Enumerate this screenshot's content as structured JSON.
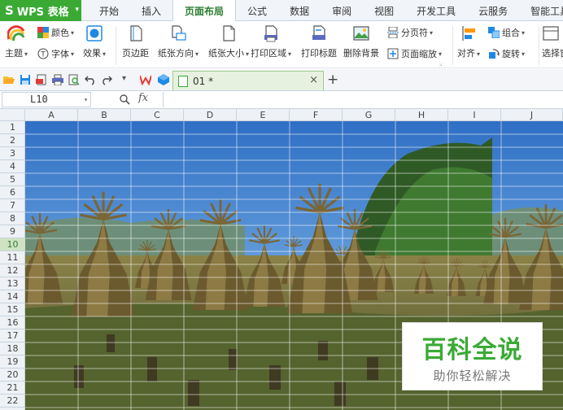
{
  "app": {
    "title": "WPS 表格",
    "tabs": [
      "开始",
      "插入",
      "页面布局",
      "公式",
      "数据",
      "审阅",
      "视图",
      "开发工具",
      "云服务",
      "智能工具箱"
    ],
    "active_tab": "页面布局"
  },
  "ribbon": {
    "theme": "主题",
    "colors": "颜色",
    "fonts": "字体",
    "effects": "效果",
    "margins": "页边距",
    "orientation": "纸张方向",
    "size": "纸张大小",
    "print_area": "打印区域",
    "print_titles": "打印标题",
    "delete_background": "删除背景",
    "page_break": "分页符",
    "page_zoom": "页面缩放",
    "align": "对齐",
    "group": "组合",
    "rotate": "旋转",
    "selection_pane": "选择窗格"
  },
  "document": {
    "tab_name": "01 *"
  },
  "formula_bar": {
    "name_box": "L10",
    "fx_label": "fx",
    "formula": ""
  },
  "sheet": {
    "columns": [
      "A",
      "B",
      "C",
      "D",
      "E",
      "F",
      "G",
      "H",
      "I",
      "J"
    ],
    "rows": [
      "1",
      "2",
      "3",
      "4",
      "5",
      "6",
      "7",
      "8",
      "9",
      "10",
      "11",
      "12",
      "13",
      "14",
      "15",
      "16",
      "17",
      "18",
      "19",
      "20",
      "21",
      "22"
    ],
    "selected_row": "10"
  },
  "watermark": {
    "title": "百科全说",
    "subtitle": "助你轻松解决"
  },
  "colors": {
    "accent": "#3aaa35",
    "tab_active": "#2e7d32",
    "sky": "#3d7fd0",
    "grass": "#6c6a3a"
  }
}
